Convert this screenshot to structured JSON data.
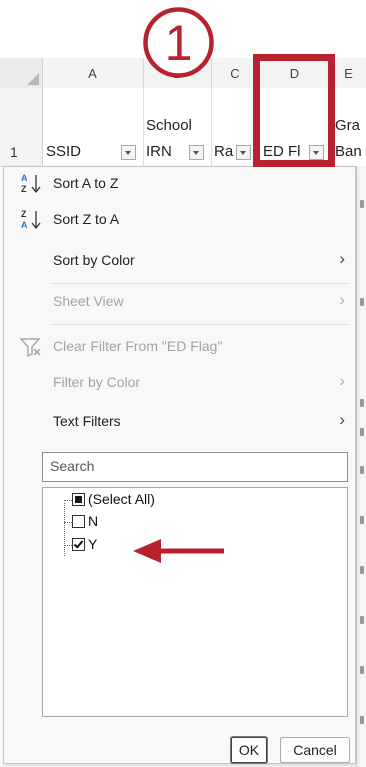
{
  "step": {
    "number": "1",
    "color": "#b8222e"
  },
  "sheet": {
    "columns": [
      "A",
      "B",
      "C",
      "D",
      "E"
    ],
    "row_number": "1",
    "headers": {
      "a": "SSID",
      "b_line1": "School",
      "b_line2": "IRN",
      "c": "Ra",
      "d": "ED Fl",
      "e_line1": "Gra",
      "e_line2": "Ban"
    }
  },
  "menu": {
    "sort_az": "Sort A to Z",
    "sort_za": "Sort Z to A",
    "sort_by_color": "Sort by Color",
    "sheet_view": "Sheet View",
    "clear_filter": "Clear Filter From \"ED Flag\"",
    "filter_by_color": "Filter by Color",
    "text_filters": "Text Filters"
  },
  "search": {
    "placeholder": "Search"
  },
  "list": {
    "items": [
      {
        "label": "(Select All)",
        "state": "partial"
      },
      {
        "label": "N",
        "state": "unchecked"
      },
      {
        "label": "Y",
        "state": "checked"
      }
    ]
  },
  "buttons": {
    "ok": "OK",
    "cancel": "Cancel"
  },
  "annotation": {
    "arrow_icon": "left-arrow",
    "arrow_color": "#b8222e"
  }
}
